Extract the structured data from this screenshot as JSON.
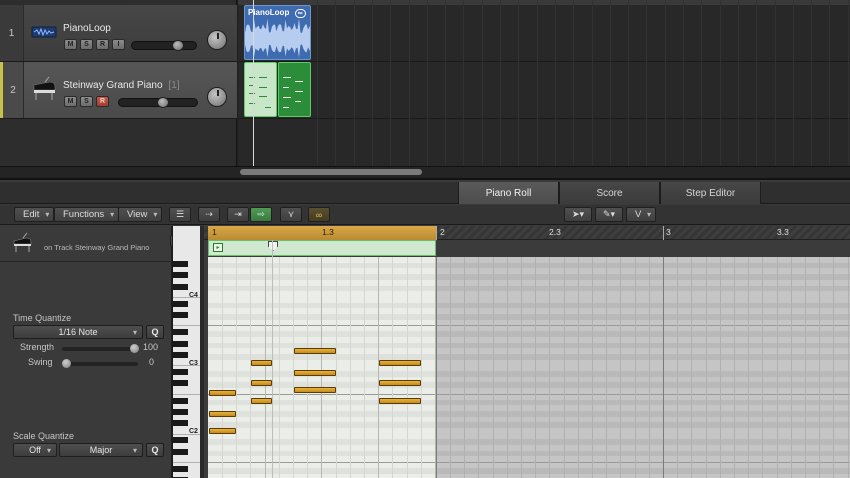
{
  "tracks": [
    {
      "num": "1",
      "name": "PianoLoop",
      "sub": "",
      "buttons": [
        "M",
        "S",
        "R",
        "I"
      ],
      "icon": "audio-waveform-icon"
    },
    {
      "num": "2",
      "name": "Steinway Grand Piano",
      "sub": "[1]",
      "buttons": [
        "M",
        "S",
        "R"
      ],
      "icon": "grand-piano-icon"
    }
  ],
  "regions": {
    "audio_title": "PianoLoop",
    "audio_loop_icon": "loop-icon"
  },
  "editor": {
    "tabs": [
      "Piano Roll",
      "Score",
      "Step Editor"
    ],
    "active_tab": "Piano Roll",
    "menus": {
      "edit": "Edit",
      "functions": "Functions",
      "view": "View"
    },
    "tools": {
      "pointer": "pointer-tool-icon",
      "pencil": "pencil-tool-icon",
      "velocity": "V"
    }
  },
  "inspector": {
    "track_label": "on Track Steinway Grand Piano",
    "time_quantize": {
      "label": "Time Quantize",
      "value": "1/16 Note",
      "q": "Q",
      "strength_label": "Strength",
      "strength": 100,
      "swing_label": "Swing",
      "swing": 0
    },
    "scale_quantize": {
      "label": "Scale Quantize",
      "root": "Off",
      "scale": "Major",
      "q": "Q"
    }
  },
  "keyboard": {
    "labels": [
      "C4",
      "C3",
      "C2"
    ]
  },
  "ruler": {
    "marks": [
      "1",
      "1.3",
      "2",
      "2.3",
      "3",
      "3.3"
    ]
  },
  "colors": {
    "accent_yellow": "#d8a84a",
    "region_blue": "#3f6cb0",
    "region_green": "#2b8d3a",
    "note_fill": "#e2a934",
    "record_red": "#b34a3c"
  }
}
